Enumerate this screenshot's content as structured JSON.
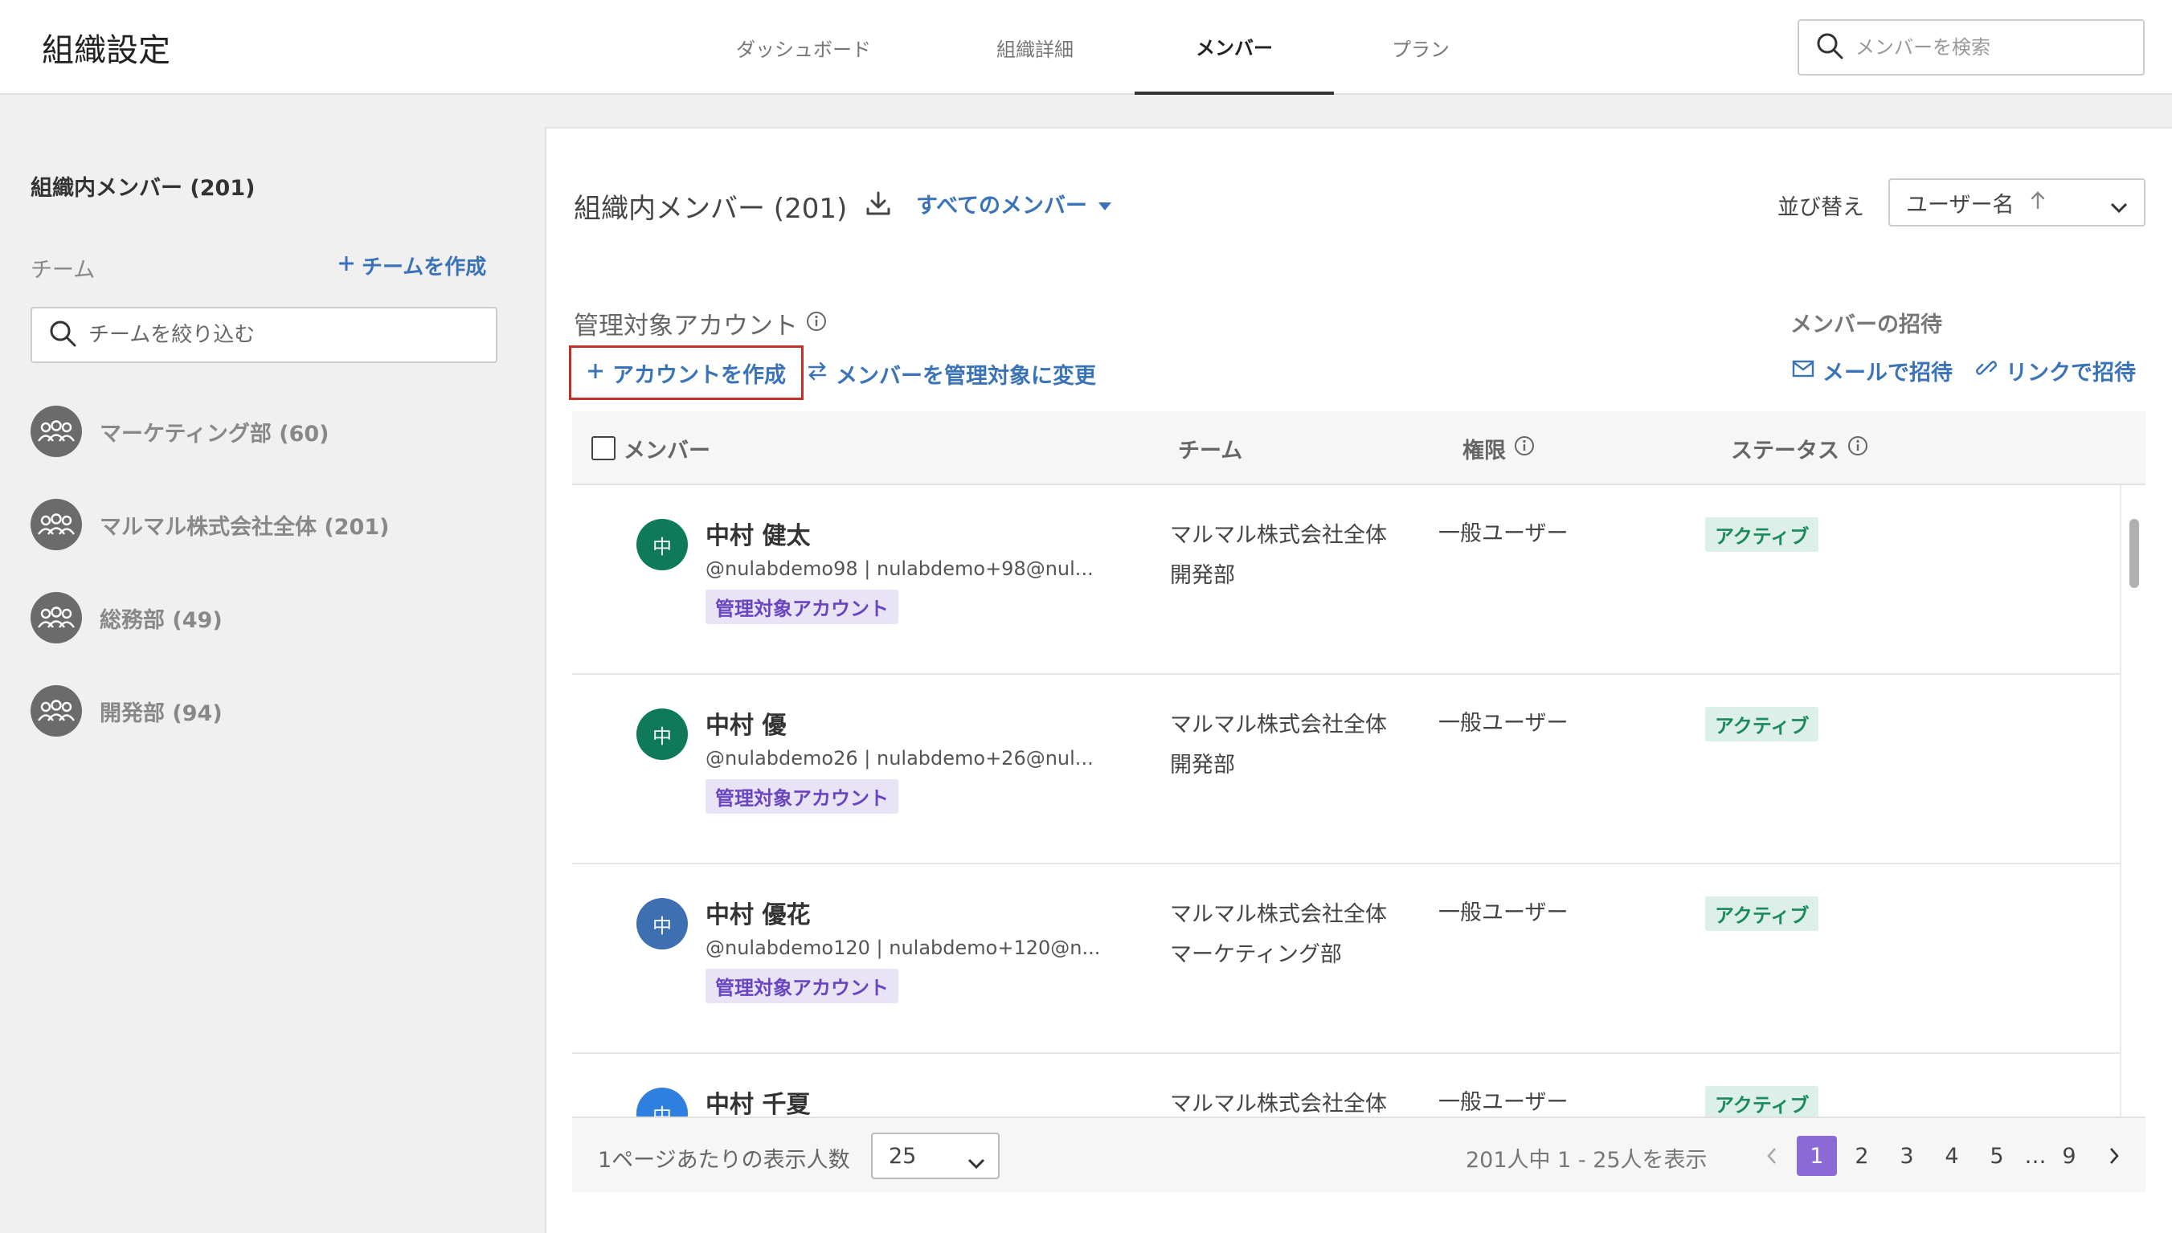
{
  "header": {
    "title": "組織設定",
    "tabs": [
      {
        "label": "ダッシュボード"
      },
      {
        "label": "組織詳細"
      },
      {
        "label": "メンバー"
      },
      {
        "label": "プラン"
      }
    ],
    "search_placeholder": "メンバーを検索"
  },
  "sidebar": {
    "heading": "組織内メンバー (201)",
    "team_label": "チーム",
    "create_team": "チームを作成",
    "filter_placeholder": "チームを絞り込む",
    "teams": [
      {
        "name": "マーケティング部 (60)"
      },
      {
        "name": "マルマル株式会社全体 (201)"
      },
      {
        "name": "総務部 (49)"
      },
      {
        "name": "開発部 (94)"
      }
    ]
  },
  "main": {
    "title": "組織内メンバー (201)",
    "filter_label": "すべてのメンバー",
    "sort_label": "並び替え",
    "sort_value": "ユーザー名",
    "managed_label": "管理対象アカウント",
    "create_account": "アカウントを作成",
    "convert_label": "メンバーを管理対象に変更",
    "invite_label": "メンバーの招待",
    "invite_mail": "メールで招待",
    "invite_link": "リンクで招待"
  },
  "table": {
    "columns": [
      "メンバー",
      "チーム",
      "権限",
      "ステータス"
    ],
    "rows": [
      {
        "avatar_char": "中",
        "avatar_color": "#0f7a5a",
        "name": "中村 健太",
        "sub": "@nulabdemo98 | nulabdemo+98@nul...",
        "badge": "管理対象アカウント",
        "team1": "マルマル株式会社全体",
        "team2": "開発部",
        "role": "一般ユーザー",
        "status": "アクティブ"
      },
      {
        "avatar_char": "中",
        "avatar_color": "#0f7a5a",
        "name": "中村 優",
        "sub": "@nulabdemo26 | nulabdemo+26@nul...",
        "badge": "管理対象アカウント",
        "team1": "マルマル株式会社全体",
        "team2": "開発部",
        "role": "一般ユーザー",
        "status": "アクティブ"
      },
      {
        "avatar_char": "中",
        "avatar_color": "#3e6fb3",
        "name": "中村 優花",
        "sub": "@nulabdemo120 | nulabdemo+120@n...",
        "badge": "管理対象アカウント",
        "team1": "マルマル株式会社全体",
        "team2": "マーケティング部",
        "role": "一般ユーザー",
        "status": "アクティブ"
      },
      {
        "avatar_char": "中",
        "avatar_color": "#2f7fe0",
        "name": "中村 千夏",
        "sub": "",
        "badge": "",
        "team1": "マルマル株式会社全体",
        "team2": "",
        "role": "一般ユーザー",
        "status": "アクティブ"
      }
    ]
  },
  "footer": {
    "per_page_label": "1ページあたりの表示人数",
    "per_page_value": "25",
    "range_text": "201人中 1 - 25人を表示",
    "pages": [
      "1",
      "2",
      "3",
      "4",
      "5",
      "…",
      "9"
    ],
    "current_page": "1"
  }
}
